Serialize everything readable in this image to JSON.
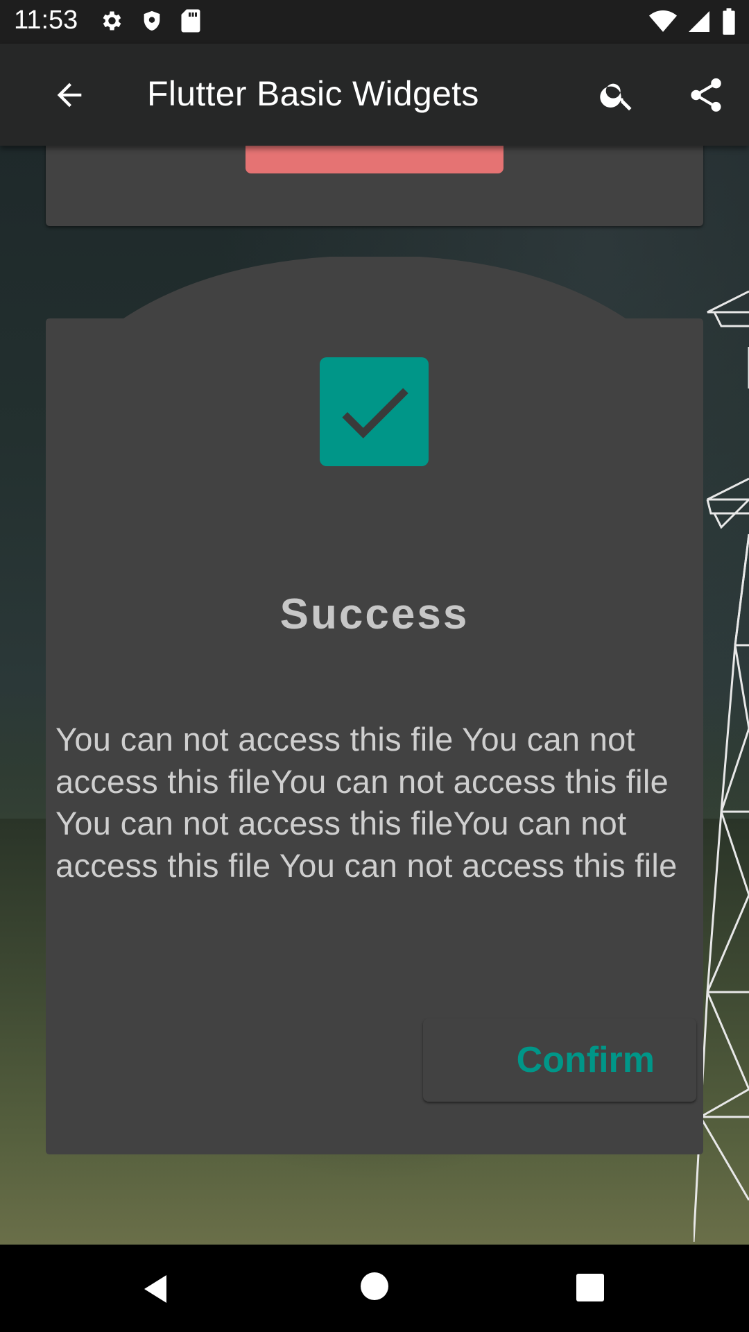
{
  "status_bar": {
    "time": "11:53",
    "icons_left": [
      "settings-icon",
      "shield-icon",
      "sd-card-icon"
    ],
    "icons_right": [
      "wifi-icon",
      "signal-icon",
      "battery-icon"
    ]
  },
  "app_bar": {
    "title": "Flutter Basic Widgets",
    "back_icon": "arrow-back-icon",
    "search_icon": "search-icon",
    "share_icon": "share-icon"
  },
  "dialog": {
    "icon": "check-box-icon",
    "title": "Success",
    "message": "You can not access this file You can not access this fileYou can not access this file You can not access this fileYou can not access this file You can not access this file",
    "confirm_label": "Confirm"
  },
  "colors": {
    "accent": "#009688",
    "dialog_bg": "#424242",
    "app_bar_bg": "#262727",
    "prev_button": "#e57373"
  },
  "nav_bar": {
    "back": "nav-back-icon",
    "home": "nav-home-icon",
    "recents": "nav-recents-icon"
  }
}
